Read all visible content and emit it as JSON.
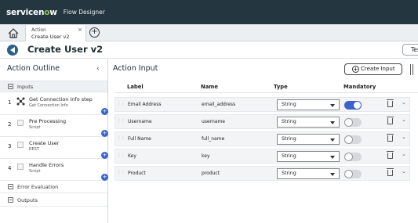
{
  "topbar": {
    "brand_prefix": "servicen",
    "brand_o": "o",
    "brand_suffix": "w",
    "product": "Flow Designer"
  },
  "tab": {
    "type": "Action",
    "title": "Create User v2",
    "close": "×"
  },
  "header": {
    "title": "Create User v2",
    "test_button": "Test"
  },
  "sidebar": {
    "title": "Action Outline",
    "inputs_label": "Inputs",
    "steps": [
      {
        "num": "1",
        "name": "Get Connection info step",
        "sub": "Get Connection Info",
        "icon": "connection-icon"
      },
      {
        "num": "2",
        "name": "Pre Processing",
        "sub": "Script",
        "icon": "image-icon"
      },
      {
        "num": "3",
        "name": "Create User",
        "sub": "REST",
        "icon": "image-icon"
      },
      {
        "num": "4",
        "name": "Handle Errors",
        "sub": "Script",
        "icon": "image-icon"
      }
    ],
    "error_evaluation_label": "Error Evaluation",
    "outputs_label": "Outputs"
  },
  "main": {
    "title": "Action Input",
    "create_input_label": "Create Input",
    "columns": {
      "label": "Label",
      "name": "Name",
      "type": "Type",
      "mandatory": "Mandatory"
    },
    "rows": [
      {
        "label": "Email Address",
        "name": "email_address",
        "type": "String",
        "mandatory": true
      },
      {
        "label": "Username",
        "name": "username",
        "type": "String",
        "mandatory": false
      },
      {
        "label": "Full Name",
        "name": "full_name",
        "type": "String",
        "mandatory": false
      },
      {
        "label": "Key",
        "name": "key",
        "type": "String",
        "mandatory": false
      },
      {
        "label": "Product",
        "name": "product",
        "type": "String",
        "mandatory": false
      }
    ]
  },
  "colors": {
    "topbar": "#243640",
    "accent": "#3b63c9",
    "brand_o": "#8dc63f"
  }
}
